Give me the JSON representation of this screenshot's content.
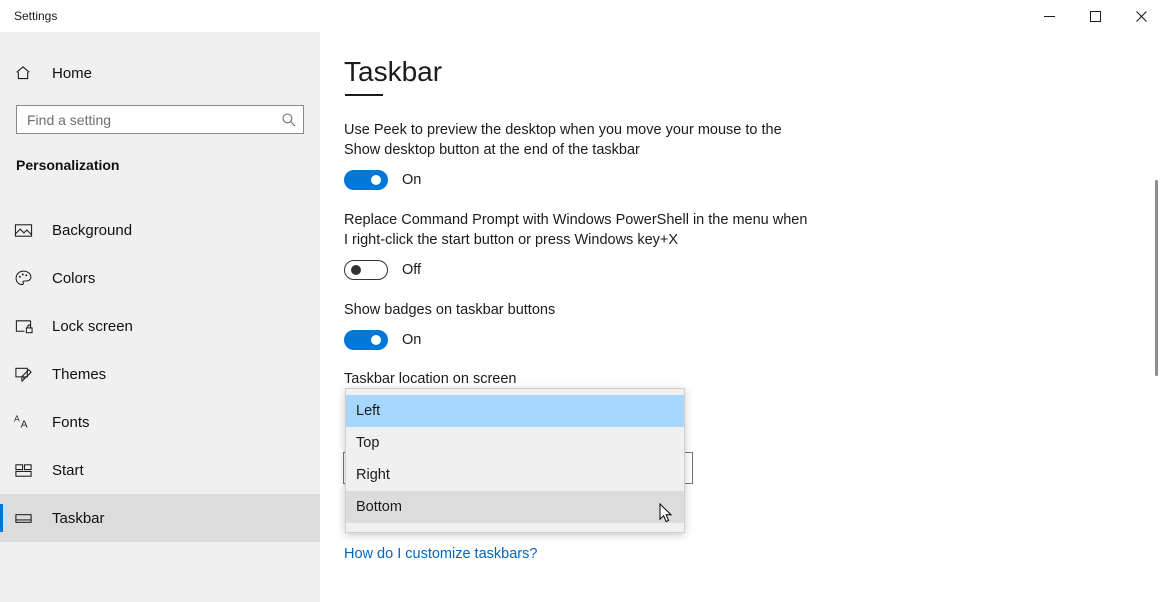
{
  "window": {
    "title": "Settings",
    "controls": {
      "minimize": "minimize-button",
      "maximize": "maximize-button",
      "close": "close-button"
    }
  },
  "sidebar": {
    "home": {
      "label": "Home",
      "icon": "home-icon"
    },
    "search": {
      "placeholder": "Find a setting",
      "value": "",
      "icon": "search-icon"
    },
    "section_title": "Personalization",
    "items": [
      {
        "label": "Background",
        "icon": "image-icon",
        "selected": false
      },
      {
        "label": "Colors",
        "icon": "palette-icon",
        "selected": false
      },
      {
        "label": "Lock screen",
        "icon": "lock-screen-icon",
        "selected": false
      },
      {
        "label": "Themes",
        "icon": "brush-icon",
        "selected": false
      },
      {
        "label": "Fonts",
        "icon": "fonts-icon",
        "selected": false
      },
      {
        "label": "Start",
        "icon": "start-tiles-icon",
        "selected": false
      },
      {
        "label": "Taskbar",
        "icon": "taskbar-icon",
        "selected": true
      }
    ]
  },
  "main": {
    "page_title": "Taskbar",
    "settings": [
      {
        "description": "Use Peek to preview the desktop when you move your mouse to the Show desktop button at the end of the taskbar",
        "toggle_state": "On",
        "toggle_on": true
      },
      {
        "description": "Replace Command Prompt with Windows PowerShell in the menu when I right-click the start button or press Windows key+X",
        "toggle_state": "Off",
        "toggle_on": false
      },
      {
        "description": "Show badges on taskbar buttons",
        "toggle_state": "On",
        "toggle_on": true
      }
    ],
    "location_field": {
      "label": "Taskbar location on screen",
      "selected_value": "",
      "expanded": true,
      "chevron": "chevron-down-icon",
      "options": [
        {
          "label": "Left",
          "state": "selected"
        },
        {
          "label": "Top",
          "state": "normal"
        },
        {
          "label": "Right",
          "state": "normal"
        },
        {
          "label": "Bottom",
          "state": "hovered"
        }
      ]
    },
    "help_link": "How do I customize taskbars?"
  },
  "colors": {
    "accent": "#0078d7",
    "link": "#0067c0",
    "sidebar_bg": "#f0f0f0",
    "dropdown_selected": "#a6d8ff",
    "dropdown_hover": "#dcdcdc"
  }
}
